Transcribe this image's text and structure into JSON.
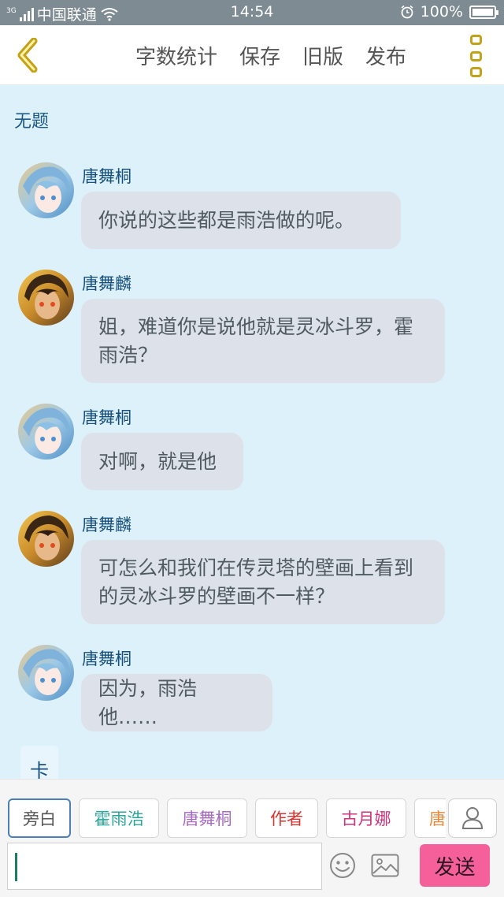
{
  "status_bar": {
    "network_tag": "3G",
    "carrier": "中国联通",
    "time": "14:54",
    "battery": "100%"
  },
  "toolbar": {
    "back_icon": "chevron-left-icon",
    "actions": [
      "字数统计",
      "保存",
      "旧版",
      "发布"
    ],
    "more_icon": "more-vertical-icon"
  },
  "document": {
    "title": "无题"
  },
  "messages": [
    {
      "speaker": "唐舞桐",
      "avatar": "tang-wutong-avatar",
      "text": "你说的这些都是雨浩做的呢。"
    },
    {
      "speaker": "唐舞麟",
      "avatar": "tang-wulin-avatar",
      "text": "姐，难道你是说他就是灵冰斗罗，霍雨浩？"
    },
    {
      "speaker": "唐舞桐",
      "avatar": "tang-wutong-avatar",
      "text": "对啊，就是他"
    },
    {
      "speaker": "唐舞麟",
      "avatar": "tang-wulin-avatar",
      "text": "可怎么和我们在传灵塔的壁画上看到的灵冰斗罗的壁画不一样？"
    },
    {
      "speaker": "唐舞桐",
      "avatar": "tang-wutong-avatar",
      "text": "因为，雨浩他……"
    }
  ],
  "card_tab": "卡",
  "roles": [
    {
      "label": "旁白",
      "color": "#555555"
    },
    {
      "label": "霍雨浩",
      "color": "#2aa59a"
    },
    {
      "label": "唐舞桐",
      "color": "#a86bc4"
    },
    {
      "label": "作者",
      "color": "#d9332f"
    },
    {
      "label": "古月娜",
      "color": "#d0327a"
    },
    {
      "label": "唐舞麟",
      "color": "#e8893a"
    }
  ],
  "composer": {
    "input_value": "",
    "send_label": "发送",
    "emoji_icon": "smiley-icon",
    "image_icon": "image-icon",
    "profile_icon": "user-icon"
  },
  "colors": {
    "accent": "#f5609a",
    "back_icon": "#c3a21a",
    "speaker_name": "#17507c",
    "background": "#ddf1fb"
  }
}
